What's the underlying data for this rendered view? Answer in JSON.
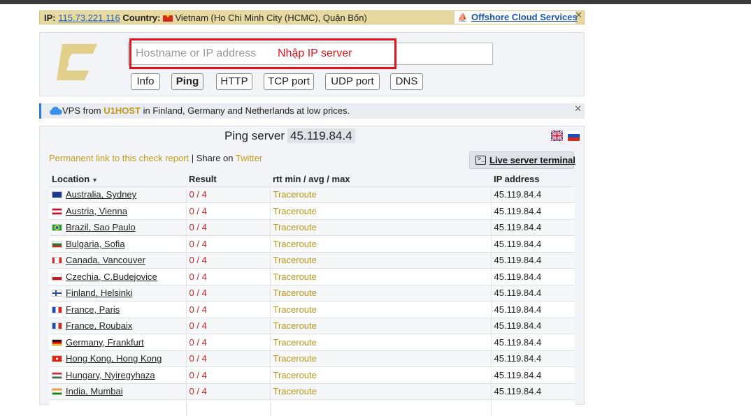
{
  "ipbar": {
    "ip_label": "IP:",
    "ip_value": "115.73.221.116",
    "country_label": "Country:",
    "country_value": "Vietnam (Ho Chi Minh City (HCMC), Quận Bốn)",
    "offshore_link": "Offshore Cloud Services",
    "close": "✕"
  },
  "search": {
    "placeholder": "Hostname or IP address",
    "annotation": "Nhập IP server",
    "tabs": [
      "Info",
      "Ping",
      "HTTP",
      "TCP port",
      "UDP port",
      "DNS"
    ],
    "active_tab": "Ping"
  },
  "vps": {
    "prefix": "VPS from",
    "brand": "U1HOST",
    "suffix": "in Finland, Germany and Netherlands at low prices.",
    "close": "✕"
  },
  "result": {
    "title": "Ping server",
    "server": "45.119.84.4",
    "permalink": "Permanent link to this check report",
    "share_sep": " | Share on ",
    "twitter": "Twitter",
    "terminal": "Live server terminal",
    "columns": {
      "location": "Location",
      "result": "Result",
      "rtt": "rtt min / avg / max",
      "ip": "IP address"
    },
    "rows": [
      {
        "location": "Australia, Sydney",
        "result": "0 / 4",
        "rtt": "Traceroute",
        "ip": "45.119.84.4",
        "flag": "au"
      },
      {
        "location": "Austria, Vienna",
        "result": "0 / 4",
        "rtt": "Traceroute",
        "ip": "45.119.84.4",
        "flag": "at"
      },
      {
        "location": "Brazil, Sao Paulo",
        "result": "0 / 4",
        "rtt": "Traceroute",
        "ip": "45.119.84.4",
        "flag": "br"
      },
      {
        "location": "Bulgaria, Sofia",
        "result": "0 / 4",
        "rtt": "Traceroute",
        "ip": "45.119.84.4",
        "flag": "bg"
      },
      {
        "location": "Canada, Vancouver",
        "result": "0 / 4",
        "rtt": "Traceroute",
        "ip": "45.119.84.4",
        "flag": "ca"
      },
      {
        "location": "Czechia, C.Budejovice",
        "result": "0 / 4",
        "rtt": "Traceroute",
        "ip": "45.119.84.4",
        "flag": "cz"
      },
      {
        "location": "Finland, Helsinki",
        "result": "0 / 4",
        "rtt": "Traceroute",
        "ip": "45.119.84.4",
        "flag": "fi"
      },
      {
        "location": "France, Paris",
        "result": "0 / 4",
        "rtt": "Traceroute",
        "ip": "45.119.84.4",
        "flag": "fr"
      },
      {
        "location": "France, Roubaix",
        "result": "0 / 4",
        "rtt": "Traceroute",
        "ip": "45.119.84.4",
        "flag": "fr"
      },
      {
        "location": "Germany, Frankfurt",
        "result": "0 / 4",
        "rtt": "Traceroute",
        "ip": "45.119.84.4",
        "flag": "de"
      },
      {
        "location": "Hong Kong, Hong Kong",
        "result": "0 / 4",
        "rtt": "Traceroute",
        "ip": "45.119.84.4",
        "flag": "hk"
      },
      {
        "location": "Hungary, Nyiregyhaza",
        "result": "0 / 4",
        "rtt": "Traceroute",
        "ip": "45.119.84.4",
        "flag": "hu"
      },
      {
        "location": "India, Mumbai",
        "result": "0 / 4",
        "rtt": "Traceroute",
        "ip": "45.119.84.4",
        "flag": "in"
      },
      {
        "location": "",
        "result": "",
        "rtt": "",
        "ip": "",
        "flag": ""
      }
    ]
  },
  "colors": {
    "accent_gold": "#c29a18",
    "error_red": "#cc2222",
    "annotation_red": "#e3111b",
    "link_blue": "#1a56b0"
  }
}
